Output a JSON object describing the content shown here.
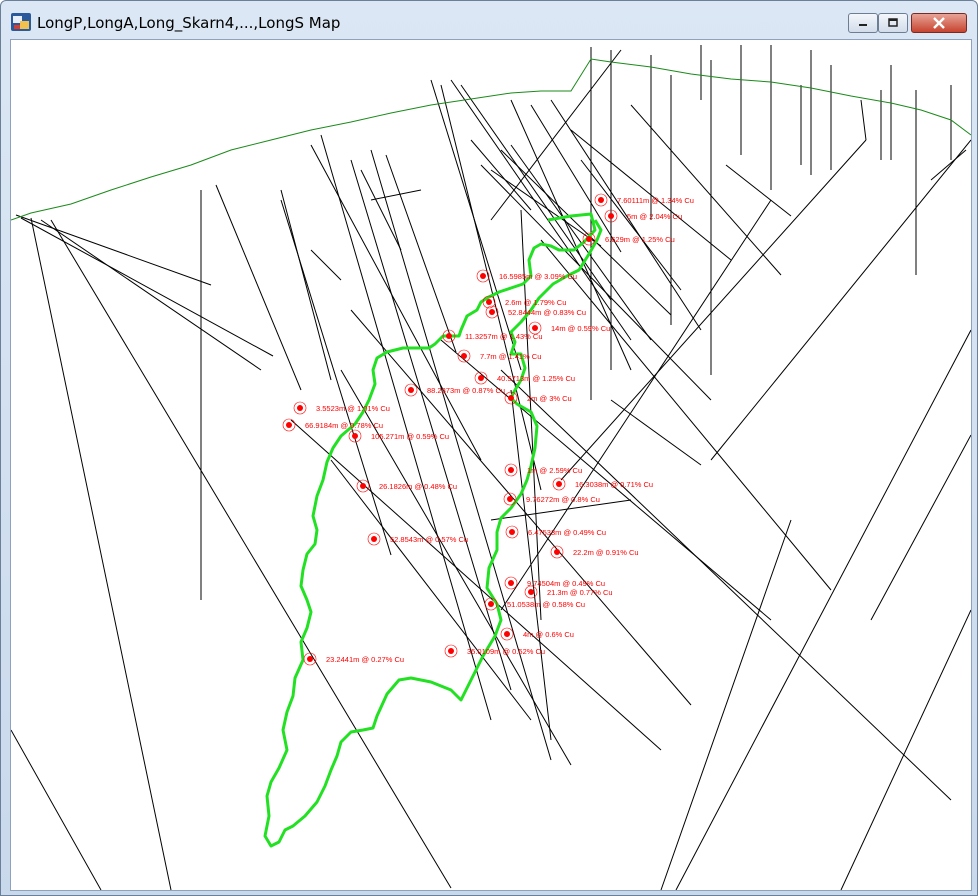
{
  "window": {
    "title": "LongP,LongA,Long_Skarn4,...,LongS Map",
    "controls": [
      "minimize",
      "maximize",
      "close"
    ]
  },
  "map": {
    "colors": {
      "surface": "#1a8a1a",
      "outline": "#22e022",
      "drillholes": "#000000",
      "intercepts": "#ff0000"
    },
    "intercepts": [
      "7.60111m @ 1.34% Cu",
      "5m @ 2.04% Cu",
      "6.629m @ 1.25% Cu",
      "16.5985m @ 3.09% Cu",
      "2.6m @ 1.79% Cu",
      "52.8444m @ 0.83% Cu",
      "14m @ 0.59% Cu",
      "11.3257m @ 1.43% Cu",
      "7.7m @ 1.41% Cu",
      "40.5713m @ 1.25% Cu",
      "88.2373m @ 0.87% Cu",
      "2m @ 3% Cu",
      "3.5523m @ 1.01% Cu",
      "66.9184m @ 0.78% Cu",
      "105.271m @ 0.59% Cu",
      "1m @ 2.59% Cu",
      "16.3038m @ 0.71% Cu",
      "26.1826m @ 0.48% Cu",
      "9.76272m @ 0.8% Cu",
      "6.47533m @ 0.49% Cu",
      "52.8543m @ 0.57% Cu",
      "22.2m @ 0.91% Cu",
      "9.74504m @ 0.49% Cu",
      "21.3m @ 0.77% Cu",
      "51.0538m @ 0.58% Cu",
      "4m @ 0.6% Cu",
      "35.0109m @ 0.52% Cu",
      "23.2441m @ 0.27% Cu"
    ]
  }
}
